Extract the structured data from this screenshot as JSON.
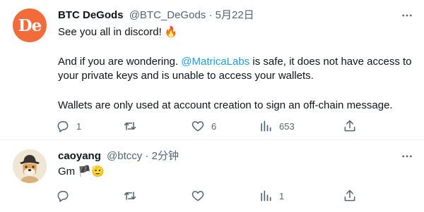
{
  "tweets": [
    {
      "avatar_text": "De",
      "avatar_color": "#f26b3a",
      "display_name": "BTC DeGods",
      "handle": "@BTC_DeGods",
      "separator": "·",
      "timestamp": "5月22日",
      "line1": "See you all in discord! 🔥",
      "line2_pre": "And if you are wondering. ",
      "line2_mention": "@MatricaLabs",
      "line2_post": " is safe, it does not have access to your private keys and is unable to access your wallets.",
      "line3": "Wallets are only used at account creation to sign an off-chain message.",
      "reply_count": "1",
      "retweet_count": "",
      "like_count": "6",
      "view_count": "653"
    },
    {
      "display_name": "caoyang",
      "handle": "@btccy",
      "separator": "·",
      "timestamp": "2分钟",
      "text": "Gm 🏴🫡",
      "reply_count": "",
      "retweet_count": "",
      "like_count": "",
      "view_count": "1"
    }
  ],
  "icons": {
    "more": "more-dots-icon",
    "reply": "reply-icon",
    "retweet": "retweet-icon",
    "like": "like-heart-icon",
    "views": "views-bar-icon",
    "share": "share-icon"
  },
  "colors": {
    "text": "#0f1419",
    "secondary": "#536471",
    "link": "#1d9bf0",
    "divider": "#eff3f4"
  }
}
